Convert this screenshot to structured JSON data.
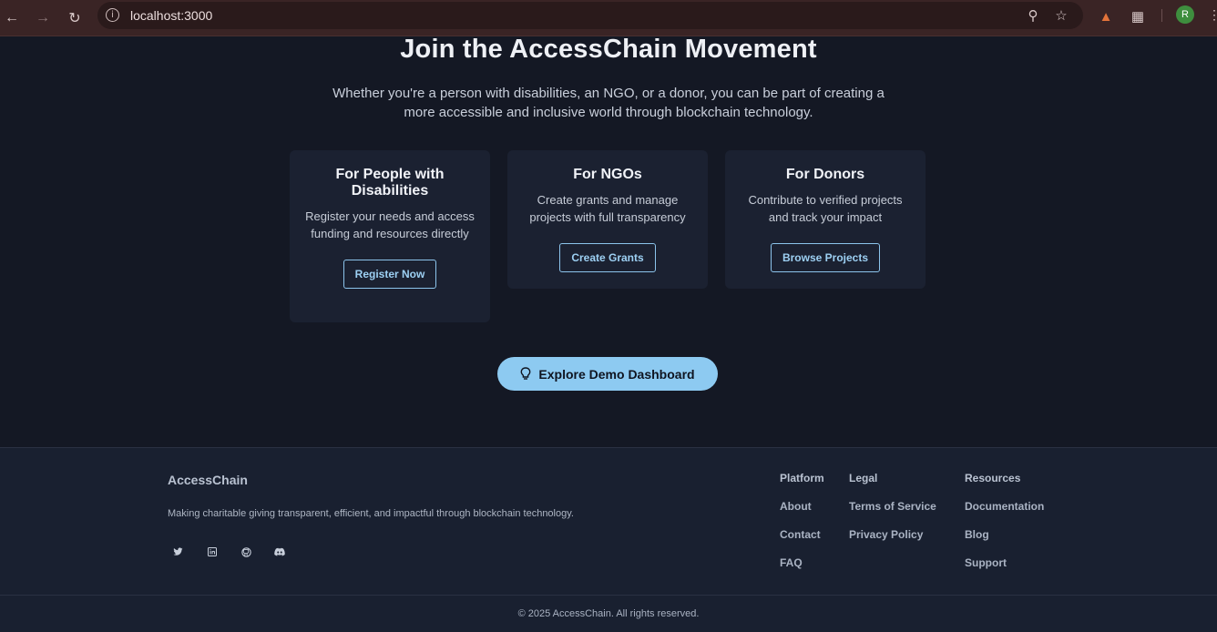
{
  "browser": {
    "url": "localhost:3000",
    "profile_initial": "R"
  },
  "join": {
    "title": "Join the AccessChain Movement",
    "subtitle": "Whether you're a person with disabilities, an NGO, or a donor, you can be part of creating a more accessible and inclusive world through blockchain technology."
  },
  "cards": [
    {
      "title": "For People with Disabilities",
      "description": "Register your needs and access funding and resources directly",
      "button": "Register Now"
    },
    {
      "title": "For NGOs",
      "description": "Create grants and manage projects with full transparency",
      "button": "Create Grants"
    },
    {
      "title": "For Donors",
      "description": "Contribute to verified projects and track your impact",
      "button": "Browse Projects"
    }
  ],
  "cta": {
    "label": "Explore Demo Dashboard"
  },
  "footer": {
    "brand": "AccessChain",
    "tagline": "Making charitable giving transparent, efficient, and impactful through blockchain technology.",
    "columns": [
      {
        "heading": "Platform",
        "links": [
          "About",
          "Contact",
          "FAQ"
        ]
      },
      {
        "heading": "Legal",
        "links": [
          "Terms of Service",
          "Privacy Policy"
        ]
      },
      {
        "heading": "Resources",
        "links": [
          "Documentation",
          "Blog",
          "Support"
        ]
      }
    ],
    "copyright": "© 2025 AccessChain. All rights reserved."
  }
}
